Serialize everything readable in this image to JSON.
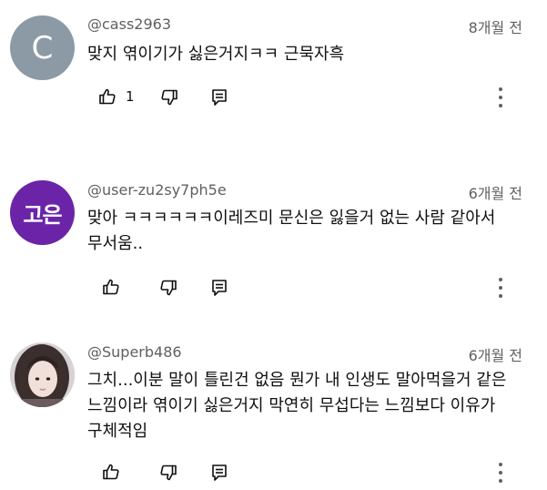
{
  "comments": [
    {
      "handle": "@cass2963",
      "time": "8개월 전",
      "text": "맞지 엮이기가 싫은거지ㅋㅋ 근묵자흑",
      "likes": "1",
      "avatar_letter": "C",
      "avatar_color": "#8b9aa5"
    },
    {
      "handle": "@user-zu2sy7ph5e",
      "time": "6개월 전",
      "text": "맞아 ㅋㅋㅋㅋㅋㅋ이레즈미 문신은 잃을거 없는 사람 같아서 무서움..",
      "likes": "",
      "avatar_letter": "고은",
      "avatar_color": "#6b24a8"
    },
    {
      "handle": "@Superb486",
      "time": "6개월 전",
      "text": "그치...이분 말이 틀린건 없음 뭔가 내 인생도 말아먹을거 같은 느낌이라 엮이기 싫은거지 막연히 무섭다는 느낌보다 이유가 구체적임",
      "likes": "",
      "avatar_letter": "",
      "avatar_color": "#c9c4c6"
    }
  ],
  "icons": {
    "like": "thumbs-up-icon",
    "dislike": "thumbs-down-icon",
    "reply": "reply-comment-icon",
    "more": "more-vertical-icon"
  }
}
